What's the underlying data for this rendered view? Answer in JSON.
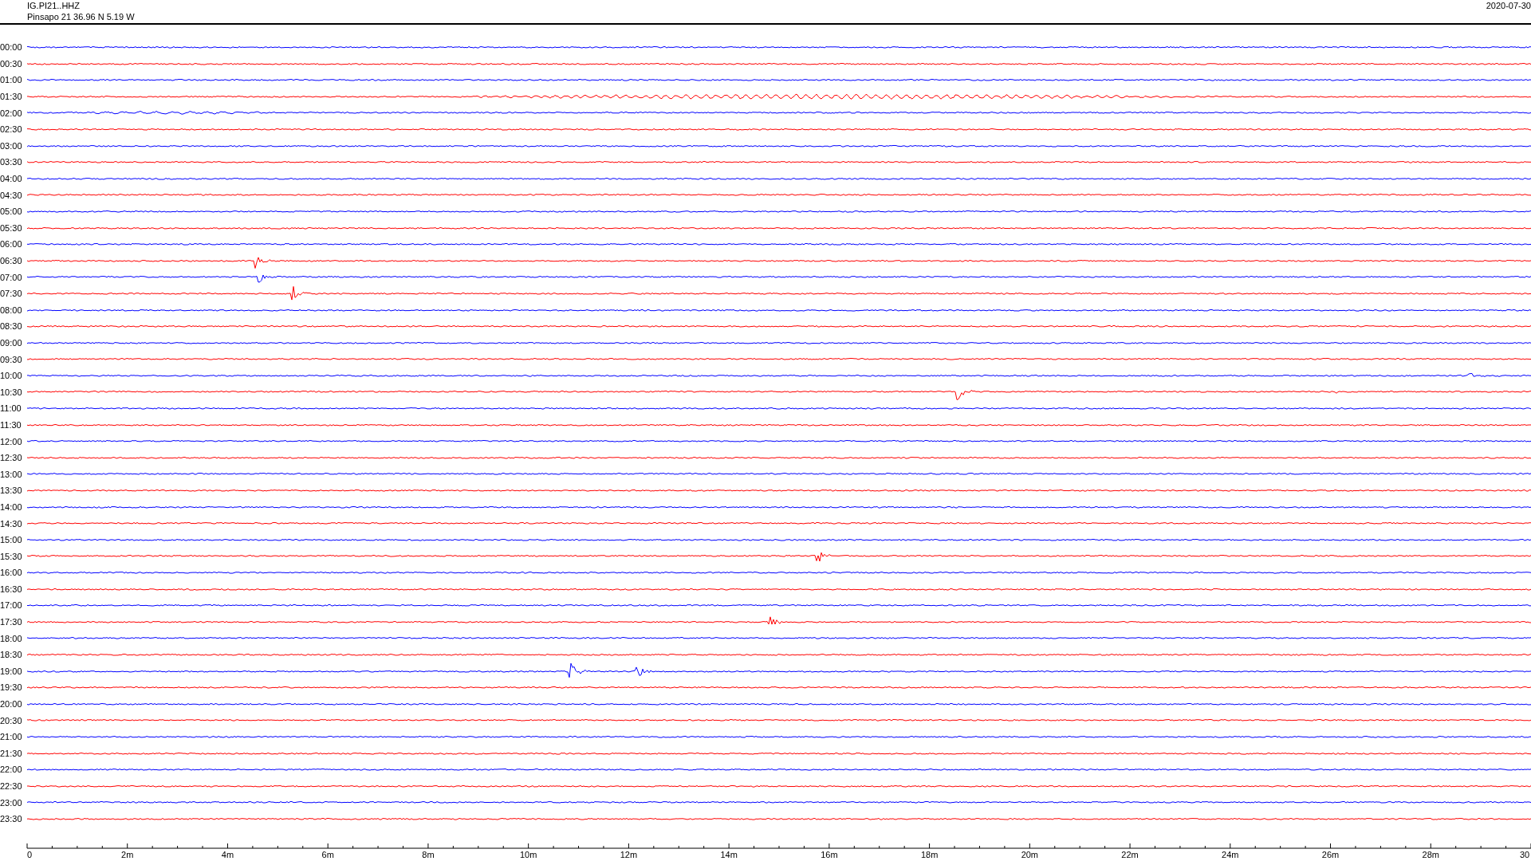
{
  "header": {
    "station": "IG.PI21..HHZ",
    "location": "Pinsapo 21  36.96 N 5.19 W",
    "date": "2020-07-30"
  },
  "rows": [
    {
      "time": "00:00",
      "color": "#0000ff"
    },
    {
      "time": "00:30",
      "color": "#ff0000"
    },
    {
      "time": "01:00",
      "color": "#0000ff"
    },
    {
      "time": "01:30",
      "color": "#ff0000"
    },
    {
      "time": "02:00",
      "color": "#0000ff"
    },
    {
      "time": "02:30",
      "color": "#ff0000"
    },
    {
      "time": "03:00",
      "color": "#0000ff"
    },
    {
      "time": "03:30",
      "color": "#ff0000"
    },
    {
      "time": "04:00",
      "color": "#0000ff"
    },
    {
      "time": "04:30",
      "color": "#ff0000"
    },
    {
      "time": "05:00",
      "color": "#0000ff"
    },
    {
      "time": "05:30",
      "color": "#ff0000"
    },
    {
      "time": "06:00",
      "color": "#0000ff"
    },
    {
      "time": "06:30",
      "color": "#ff0000"
    },
    {
      "time": "07:00",
      "color": "#0000ff"
    },
    {
      "time": "07:30",
      "color": "#ff0000"
    },
    {
      "time": "08:00",
      "color": "#0000ff"
    },
    {
      "time": "08:30",
      "color": "#ff0000"
    },
    {
      "time": "09:00",
      "color": "#0000ff"
    },
    {
      "time": "09:30",
      "color": "#ff0000"
    },
    {
      "time": "10:00",
      "color": "#0000ff"
    },
    {
      "time": "10:30",
      "color": "#ff0000"
    },
    {
      "time": "11:00",
      "color": "#0000ff"
    },
    {
      "time": "11:30",
      "color": "#ff0000"
    },
    {
      "time": "12:00",
      "color": "#0000ff"
    },
    {
      "time": "12:30",
      "color": "#ff0000"
    },
    {
      "time": "13:00",
      "color": "#0000ff"
    },
    {
      "time": "13:30",
      "color": "#ff0000"
    },
    {
      "time": "14:00",
      "color": "#0000ff"
    },
    {
      "time": "14:30",
      "color": "#ff0000"
    },
    {
      "time": "15:00",
      "color": "#0000ff"
    },
    {
      "time": "15:30",
      "color": "#ff0000"
    },
    {
      "time": "16:00",
      "color": "#0000ff"
    },
    {
      "time": "16:30",
      "color": "#ff0000"
    },
    {
      "time": "17:00",
      "color": "#0000ff"
    },
    {
      "time": "17:30",
      "color": "#ff0000"
    },
    {
      "time": "18:00",
      "color": "#0000ff"
    },
    {
      "time": "18:30",
      "color": "#ff0000"
    },
    {
      "time": "19:00",
      "color": "#0000ff"
    },
    {
      "time": "19:30",
      "color": "#ff0000"
    },
    {
      "time": "20:00",
      "color": "#0000ff"
    },
    {
      "time": "20:30",
      "color": "#ff0000"
    },
    {
      "time": "21:00",
      "color": "#0000ff"
    },
    {
      "time": "21:30",
      "color": "#ff0000"
    },
    {
      "time": "22:00",
      "color": "#0000ff"
    },
    {
      "time": "22:30",
      "color": "#ff0000"
    },
    {
      "time": "23:00",
      "color": "#0000ff"
    },
    {
      "time": "23:30",
      "color": "#ff0000"
    }
  ],
  "axis": {
    "labels": [
      "0",
      "2m",
      "4m",
      "6m",
      "8m",
      "10m",
      "12m",
      "14m",
      "16m",
      "18m",
      "20m",
      "22m",
      "24m",
      "26m",
      "28m",
      "30"
    ]
  }
}
